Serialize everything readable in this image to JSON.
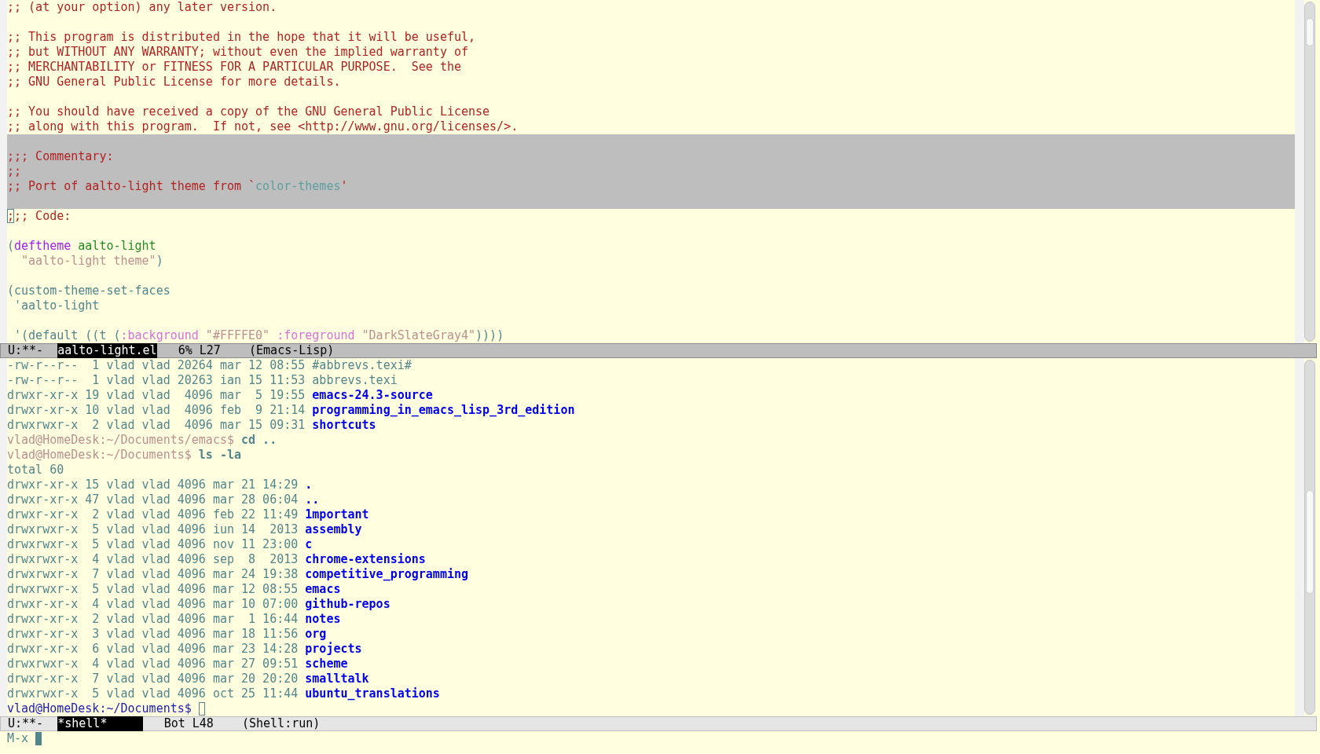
{
  "editor": {
    "paragraphs": [
      {
        "highlighted": false,
        "lines": [
          {
            "segments": [
              {
                "text": ";; (at your option) any later version.",
                "kind": "comment"
              }
            ]
          }
        ]
      },
      {
        "highlighted": false,
        "lines": [
          {
            "segments": [
              {
                "text": ";; This program is distributed in the hope that it will be useful,",
                "kind": "comment"
              }
            ]
          },
          {
            "segments": [
              {
                "text": ";; but WITHOUT ANY WARRANTY; without even the implied warranty of",
                "kind": "comment"
              }
            ]
          },
          {
            "segments": [
              {
                "text": ";; MERCHANTABILITY or FITNESS FOR A PARTICULAR PURPOSE.  See the",
                "kind": "comment"
              }
            ]
          },
          {
            "segments": [
              {
                "text": ";; GNU General Public License for more details.",
                "kind": "comment"
              }
            ]
          }
        ]
      },
      {
        "highlighted": false,
        "lines": [
          {
            "segments": [
              {
                "text": ";; You should have received a copy of the GNU General Public License",
                "kind": "comment"
              }
            ]
          },
          {
            "segments": [
              {
                "text": ";; along with this program.  If not, see <http://www.gnu.org/licenses/>.",
                "kind": "comment"
              }
            ]
          }
        ]
      },
      {
        "highlighted": true,
        "lines": [
          {
            "segments": [
              {
                "text": ";;; Commentary:",
                "kind": "comment"
              }
            ]
          },
          {
            "segments": [
              {
                "text": ";;",
                "kind": "comment"
              }
            ]
          },
          {
            "segments": [
              {
                "text": ";; Port of aalto-light theme from `",
                "kind": "comment"
              },
              {
                "text": "color-themes",
                "kind": "constant"
              },
              {
                "text": "'",
                "kind": "comment"
              }
            ]
          }
        ]
      },
      {
        "highlighted": false,
        "lines": [
          {
            "segments": [
              {
                "text": ";",
                "kind": "cursor"
              },
              {
                "text": ";; Code:",
                "kind": "comment"
              }
            ]
          }
        ]
      },
      {
        "highlighted": false,
        "lines": [
          {
            "segments": [
              {
                "text": "(",
                "kind": "default"
              },
              {
                "text": "deftheme",
                "kind": "keyword"
              },
              {
                "text": " aalto-light",
                "kind": "function"
              }
            ]
          },
          {
            "segments": [
              {
                "text": "  \"aalto-light theme\"",
                "kind": "string"
              },
              {
                "text": ")",
                "kind": "default"
              }
            ]
          }
        ]
      },
      {
        "highlighted": false,
        "lines": [
          {
            "segments": [
              {
                "text": "(custom-theme-set-faces",
                "kind": "default"
              }
            ]
          },
          {
            "segments": [
              {
                "text": " 'aalto-light",
                "kind": "default"
              }
            ]
          }
        ]
      },
      {
        "highlighted": false,
        "lines": [
          {
            "segments": [
              {
                "text": " '(default ((t (",
                "kind": "default"
              },
              {
                "text": ":background",
                "kind": "builtin"
              },
              {
                "text": " \"#FFFFE0\"",
                "kind": "string"
              },
              {
                "text": " :foreground",
                "kind": "builtin"
              },
              {
                "text": " \"DarkSlateGray4\"",
                "kind": "string"
              },
              {
                "text": "))))",
                "kind": "default"
              }
            ]
          }
        ]
      }
    ]
  },
  "editor_mode_line": {
    "active": true,
    "status": "U:**-",
    "buffer": "aalto-light.el",
    "position": "6% L27",
    "mode": "(Emacs-Lisp)"
  },
  "shell": {
    "lines": [
      {
        "kind": "listing",
        "info": "-rw-r--r--  1 vlad vlad 20264 mar 12 08:55",
        "name": "#abbrevs.texi#",
        "directory": false
      },
      {
        "kind": "listing",
        "info": "-rw-r--r--  1 vlad vlad 20263 ian 15 11:53",
        "name": "abbrevs.texi",
        "directory": false
      },
      {
        "kind": "listing",
        "info": "drwxr-xr-x 19 vlad vlad  4096 mar  5 19:55",
        "name": "emacs-24.3-source",
        "directory": true
      },
      {
        "kind": "listing",
        "info": "drwxr-xr-x 10 vlad vlad  4096 feb  9 21:14",
        "name": "programming_in_emacs_lisp_3rd_edition",
        "directory": true
      },
      {
        "kind": "listing",
        "info": "drwxrwxr-x  2 vlad vlad  4096 mar 15 09:31",
        "name": "shortcuts",
        "directory": true
      },
      {
        "kind": "prompt",
        "prompt": "vlad@HomeDesk:~/Documents/emacs$",
        "command": "cd ..",
        "cursor": false
      },
      {
        "kind": "prompt",
        "prompt": "vlad@HomeDesk:~/Documents$",
        "command": "ls -la",
        "cursor": false
      },
      {
        "kind": "output",
        "text": "total 60"
      },
      {
        "kind": "listing",
        "info": "drwxr-xr-x 15 vlad vlad 4096 mar 21 14:29",
        "name": ".",
        "directory": true
      },
      {
        "kind": "listing",
        "info": "drwxr-xr-x 47 vlad vlad 4096 mar 28 06:04",
        "name": "..",
        "directory": true
      },
      {
        "kind": "listing",
        "info": "drwxr-xr-x  2 vlad vlad 4096 feb 22 11:49",
        "name": "1mportant",
        "directory": true
      },
      {
        "kind": "listing",
        "info": "drwxrwxr-x  5 vlad vlad 4096 iun 14  2013",
        "name": "assembly",
        "directory": true
      },
      {
        "kind": "listing",
        "info": "drwxrwxr-x  5 vlad vlad 4096 nov 11 23:00",
        "name": "c",
        "directory": true
      },
      {
        "kind": "listing",
        "info": "drwxrwxr-x  4 vlad vlad 4096 sep  8  2013",
        "name": "chrome-extensions",
        "directory": true
      },
      {
        "kind": "listing",
        "info": "drwxrwxr-x  7 vlad vlad 4096 mar 24 19:38",
        "name": "competitive_programming",
        "directory": true
      },
      {
        "kind": "listing",
        "info": "drwxrwxr-x  5 vlad vlad 4096 mar 12 08:55",
        "name": "emacs",
        "directory": true
      },
      {
        "kind": "listing",
        "info": "drwxr-xr-x  4 vlad vlad 4096 mar 10 07:00",
        "name": "github-repos",
        "directory": true
      },
      {
        "kind": "listing",
        "info": "drwxr-xr-x  2 vlad vlad 4096 mar  1 16:44",
        "name": "notes",
        "directory": true
      },
      {
        "kind": "listing",
        "info": "drwxr-xr-x  3 vlad vlad 4096 mar 18 11:56",
        "name": "org",
        "directory": true
      },
      {
        "kind": "listing",
        "info": "drwxr-xr-x  6 vlad vlad 4096 mar 23 14:28",
        "name": "projects",
        "directory": true
      },
      {
        "kind": "listing",
        "info": "drwxrwxr-x  4 vlad vlad 4096 mar 27 09:51",
        "name": "scheme",
        "directory": true
      },
      {
        "kind": "listing",
        "info": "drwxr-xr-x  7 vlad vlad 4096 mar 20 20:20",
        "name": "smalltalk",
        "directory": true
      },
      {
        "kind": "listing",
        "info": "drwxrwxr-x  5 vlad vlad 4096 oct 25 11:44",
        "name": "ubuntu_translations",
        "directory": true
      },
      {
        "kind": "prompt",
        "prompt": "vlad@HomeDesk:~/Documents$",
        "cursor": true
      }
    ]
  },
  "shell_mode_line": {
    "active": false,
    "status": "U:**-",
    "buffer": "*shell*",
    "position": "Bot L48",
    "mode": "(Shell:run)"
  },
  "minibuffer": {
    "prompt": "M-x"
  }
}
